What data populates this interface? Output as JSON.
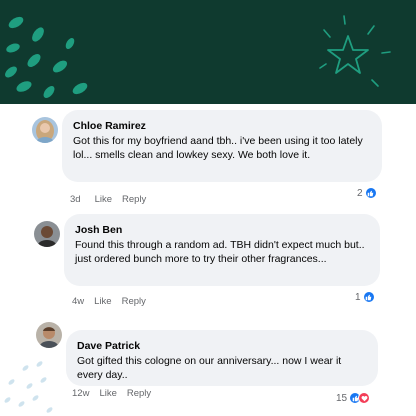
{
  "comments": [
    {
      "name": "Chloe Ramirez",
      "text": "Got this for my boyfriend aand tbh.. i've been using it too lately lol... smells clean and lowkey sexy. We both love it.",
      "time": "3d",
      "like_label": "Like",
      "reply_label": "Reply",
      "reaction_count": "2",
      "reactions": [
        "like-icon"
      ]
    },
    {
      "name": "Josh Ben",
      "text": "Found this through a random ad. TBH didn't expect much but.. just ordered bunch more to try their other fragrances...",
      "time": "4w",
      "like_label": "Like",
      "reply_label": "Reply",
      "reaction_count": "1",
      "reactions": [
        "like-icon"
      ]
    },
    {
      "name": "Dave Patrick",
      "text": "Got gifted this cologne on our anniversary... now I wear it every day..",
      "time": "12w",
      "like_label": "Like",
      "reply_label": "Reply",
      "reaction_count": "15",
      "reactions": [
        "like-icon",
        "love-icon"
      ]
    }
  ],
  "colors": {
    "banner": "#0f3a2f",
    "accent_leaf": "#1f9e80",
    "bubble": "#f0f2f5",
    "like_blue": "#1877f2",
    "love_red": "#f33e58",
    "meta_gray": "#65676b"
  }
}
